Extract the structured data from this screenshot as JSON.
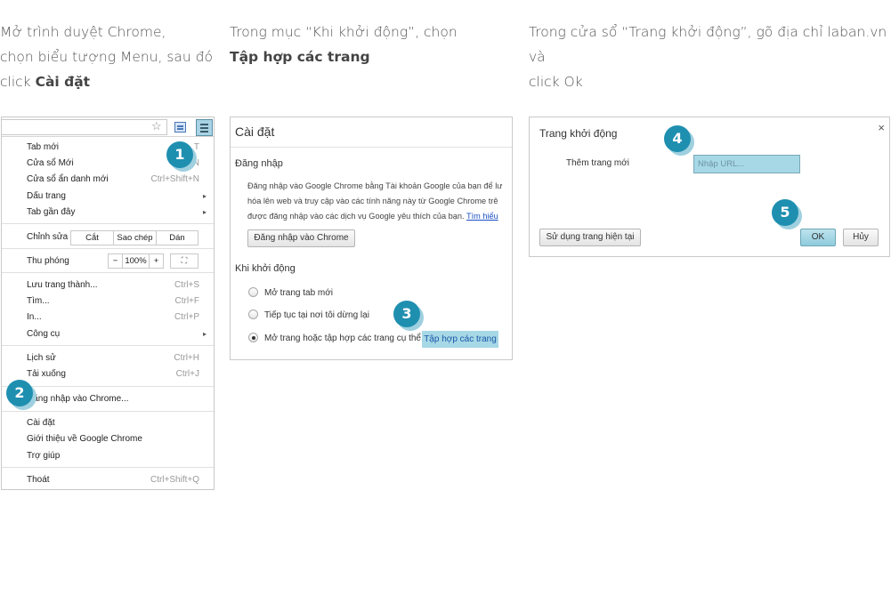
{
  "captions": {
    "step1": {
      "line1": "Mở trình duyệt Chrome,",
      "line2": "chọn biểu tượng Menu, sau đó",
      "line3_prefix": "click ",
      "line3_bold": "Cài đặt"
    },
    "step2": {
      "line1": "Trong mục “Khi khởi động”, chọn",
      "line2_bold": "Tập hợp các trang"
    },
    "step3": {
      "line1": "Trong cửa sổ “Trang khởi động”, gõ địa chỉ laban.vn và",
      "line2": "click Ok"
    }
  },
  "chrome_menu": {
    "items_top": [
      {
        "label": "Tab mới",
        "shortcut": "T"
      },
      {
        "label": "Cửa sổ Mới",
        "shortcut": "N"
      },
      {
        "label": "Cửa sổ ẩn danh mới",
        "shortcut": "Ctrl+Shift+N"
      },
      {
        "label": "Dấu trang",
        "arrow": "▸"
      },
      {
        "label": "Tab gần đây",
        "arrow": "▸"
      }
    ],
    "edit": {
      "label": "Chỉnh sửa",
      "cut": "Cắt",
      "copy": "Sao chép",
      "paste": "Dán"
    },
    "zoom": {
      "label": "Thu phóng",
      "minus": "−",
      "value": "100%",
      "plus": "+",
      "fullscreen": "⛶"
    },
    "items_mid": [
      {
        "label": "Lưu trang thành...",
        "shortcut": "Ctrl+S"
      },
      {
        "label": "Tìm...",
        "shortcut": "Ctrl+F"
      },
      {
        "label": "In...",
        "shortcut": "Ctrl+P"
      },
      {
        "label": "Công cụ",
        "arrow": "▸"
      }
    ],
    "items_hist": [
      {
        "label": "Lịch sử",
        "shortcut": "Ctrl+H"
      },
      {
        "label": "Tải xuống",
        "shortcut": "Ctrl+J"
      }
    ],
    "signin": "Đăng nhập vào Chrome...",
    "items_bottom": [
      {
        "label": "Cài đặt"
      },
      {
        "label": "Giới thiệu về Google Chrome"
      },
      {
        "label": "Trợ giúp"
      }
    ],
    "exit": {
      "label": "Thoát",
      "shortcut": "Ctrl+Shift+Q"
    }
  },
  "settings": {
    "title": "Cài đặt",
    "signin_heading": "Đăng nhập",
    "desc_line1": "Đăng nhập vào Google Chrome bằng Tài khoản Google của bạn để lư",
    "desc_line2": "hóa lên web và truy cập vào các tính năng này từ Google Chrome trê",
    "desc_line3": "được đăng nhập vào các dịch vụ Google yêu thích của bạn.",
    "desc_link": "Tìm hiểu",
    "signin_button": "Đăng nhập vào Chrome",
    "startup_heading": "Khi khởi động",
    "radio1": "Mở trang tab mới",
    "radio2": "Tiếp tục tại nơi tôi dừng lại",
    "radio3": "Mở trang hoặc tập hợp các trang cụ thể.",
    "set_pages": "Tập hợp các trang"
  },
  "dialog": {
    "title": "Trang khởi động",
    "close": "×",
    "add_label": "Thêm trang mới",
    "url_placeholder": "Nhập URL...",
    "use_current": "Sử dụng trang hiện tại",
    "ok": "OK",
    "cancel": "Hủy"
  },
  "badges": [
    "1",
    "2",
    "3",
    "4",
    "5"
  ],
  "colors": {
    "badge": "#1f8fb0",
    "badge_shadow": "#9fd0df",
    "highlight": "#a6d8e6",
    "link": "#1a4fc4"
  }
}
